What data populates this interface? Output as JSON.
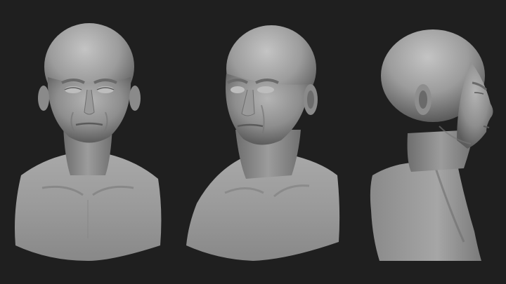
{
  "scene": {
    "description_visible_text": "",
    "background_color": "#1f1f1f",
    "clay_color": "#9a9a9a",
    "views": [
      {
        "id": "front",
        "icon": "sculpt-bust-front"
      },
      {
        "id": "three-quarter",
        "icon": "sculpt-bust-three-quarter"
      },
      {
        "id": "side",
        "icon": "sculpt-bust-profile"
      }
    ]
  }
}
